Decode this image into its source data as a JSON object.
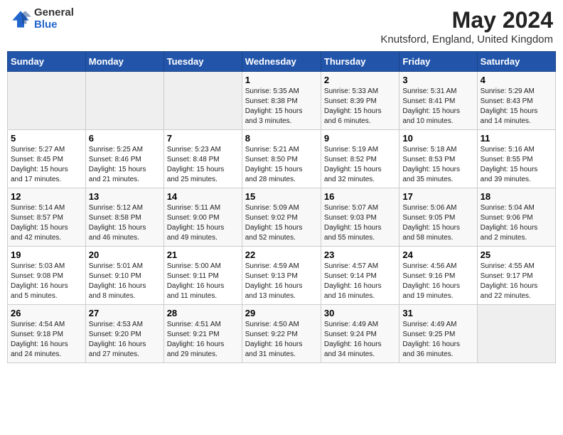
{
  "logo": {
    "general": "General",
    "blue": "Blue"
  },
  "title": {
    "month_year": "May 2024",
    "location": "Knutsford, England, United Kingdom"
  },
  "days_header": [
    "Sunday",
    "Monday",
    "Tuesday",
    "Wednesday",
    "Thursday",
    "Friday",
    "Saturday"
  ],
  "weeks": [
    [
      {
        "day": "",
        "info": ""
      },
      {
        "day": "",
        "info": ""
      },
      {
        "day": "",
        "info": ""
      },
      {
        "day": "1",
        "info": "Sunrise: 5:35 AM\nSunset: 8:38 PM\nDaylight: 15 hours\nand 3 minutes."
      },
      {
        "day": "2",
        "info": "Sunrise: 5:33 AM\nSunset: 8:39 PM\nDaylight: 15 hours\nand 6 minutes."
      },
      {
        "day": "3",
        "info": "Sunrise: 5:31 AM\nSunset: 8:41 PM\nDaylight: 15 hours\nand 10 minutes."
      },
      {
        "day": "4",
        "info": "Sunrise: 5:29 AM\nSunset: 8:43 PM\nDaylight: 15 hours\nand 14 minutes."
      }
    ],
    [
      {
        "day": "5",
        "info": "Sunrise: 5:27 AM\nSunset: 8:45 PM\nDaylight: 15 hours\nand 17 minutes."
      },
      {
        "day": "6",
        "info": "Sunrise: 5:25 AM\nSunset: 8:46 PM\nDaylight: 15 hours\nand 21 minutes."
      },
      {
        "day": "7",
        "info": "Sunrise: 5:23 AM\nSunset: 8:48 PM\nDaylight: 15 hours\nand 25 minutes."
      },
      {
        "day": "8",
        "info": "Sunrise: 5:21 AM\nSunset: 8:50 PM\nDaylight: 15 hours\nand 28 minutes."
      },
      {
        "day": "9",
        "info": "Sunrise: 5:19 AM\nSunset: 8:52 PM\nDaylight: 15 hours\nand 32 minutes."
      },
      {
        "day": "10",
        "info": "Sunrise: 5:18 AM\nSunset: 8:53 PM\nDaylight: 15 hours\nand 35 minutes."
      },
      {
        "day": "11",
        "info": "Sunrise: 5:16 AM\nSunset: 8:55 PM\nDaylight: 15 hours\nand 39 minutes."
      }
    ],
    [
      {
        "day": "12",
        "info": "Sunrise: 5:14 AM\nSunset: 8:57 PM\nDaylight: 15 hours\nand 42 minutes."
      },
      {
        "day": "13",
        "info": "Sunrise: 5:12 AM\nSunset: 8:58 PM\nDaylight: 15 hours\nand 46 minutes."
      },
      {
        "day": "14",
        "info": "Sunrise: 5:11 AM\nSunset: 9:00 PM\nDaylight: 15 hours\nand 49 minutes."
      },
      {
        "day": "15",
        "info": "Sunrise: 5:09 AM\nSunset: 9:02 PM\nDaylight: 15 hours\nand 52 minutes."
      },
      {
        "day": "16",
        "info": "Sunrise: 5:07 AM\nSunset: 9:03 PM\nDaylight: 15 hours\nand 55 minutes."
      },
      {
        "day": "17",
        "info": "Sunrise: 5:06 AM\nSunset: 9:05 PM\nDaylight: 15 hours\nand 58 minutes."
      },
      {
        "day": "18",
        "info": "Sunrise: 5:04 AM\nSunset: 9:06 PM\nDaylight: 16 hours\nand 2 minutes."
      }
    ],
    [
      {
        "day": "19",
        "info": "Sunrise: 5:03 AM\nSunset: 9:08 PM\nDaylight: 16 hours\nand 5 minutes."
      },
      {
        "day": "20",
        "info": "Sunrise: 5:01 AM\nSunset: 9:10 PM\nDaylight: 16 hours\nand 8 minutes."
      },
      {
        "day": "21",
        "info": "Sunrise: 5:00 AM\nSunset: 9:11 PM\nDaylight: 16 hours\nand 11 minutes."
      },
      {
        "day": "22",
        "info": "Sunrise: 4:59 AM\nSunset: 9:13 PM\nDaylight: 16 hours\nand 13 minutes."
      },
      {
        "day": "23",
        "info": "Sunrise: 4:57 AM\nSunset: 9:14 PM\nDaylight: 16 hours\nand 16 minutes."
      },
      {
        "day": "24",
        "info": "Sunrise: 4:56 AM\nSunset: 9:16 PM\nDaylight: 16 hours\nand 19 minutes."
      },
      {
        "day": "25",
        "info": "Sunrise: 4:55 AM\nSunset: 9:17 PM\nDaylight: 16 hours\nand 22 minutes."
      }
    ],
    [
      {
        "day": "26",
        "info": "Sunrise: 4:54 AM\nSunset: 9:18 PM\nDaylight: 16 hours\nand 24 minutes."
      },
      {
        "day": "27",
        "info": "Sunrise: 4:53 AM\nSunset: 9:20 PM\nDaylight: 16 hours\nand 27 minutes."
      },
      {
        "day": "28",
        "info": "Sunrise: 4:51 AM\nSunset: 9:21 PM\nDaylight: 16 hours\nand 29 minutes."
      },
      {
        "day": "29",
        "info": "Sunrise: 4:50 AM\nSunset: 9:22 PM\nDaylight: 16 hours\nand 31 minutes."
      },
      {
        "day": "30",
        "info": "Sunrise: 4:49 AM\nSunset: 9:24 PM\nDaylight: 16 hours\nand 34 minutes."
      },
      {
        "day": "31",
        "info": "Sunrise: 4:49 AM\nSunset: 9:25 PM\nDaylight: 16 hours\nand 36 minutes."
      },
      {
        "day": "",
        "info": ""
      }
    ]
  ]
}
